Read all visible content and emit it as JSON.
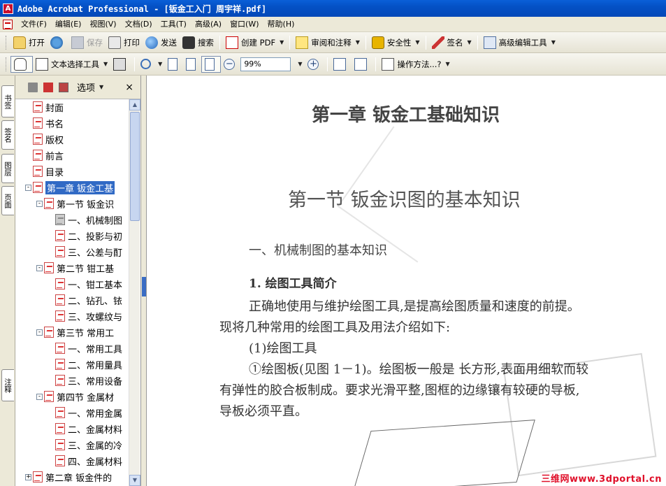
{
  "window": {
    "title": "Adobe Acrobat Professional - [钣金工入门 周宇祥.pdf]"
  },
  "menubar": {
    "items": [
      "文件(F)",
      "编辑(E)",
      "视图(V)",
      "文档(D)",
      "工具(T)",
      "高级(A)",
      "窗口(W)",
      "帮助(H)"
    ]
  },
  "toolbar1": {
    "open": "打开",
    "save": "保存",
    "print": "打印",
    "send": "发送",
    "search": "搜索",
    "create_pdf": "创建 PDF",
    "review": "审阅和注释",
    "security": "安全性",
    "sign": "签名",
    "advanced_edit": "高级编辑工具"
  },
  "toolbar2": {
    "text_select": "文本选择工具",
    "zoom_value": "99%",
    "how_to": "操作方法...?"
  },
  "lefttabs": [
    "书签",
    "签名",
    "图层",
    "页面",
    "注释"
  ],
  "nav": {
    "options": "选项",
    "close": "×"
  },
  "bookmarks": [
    {
      "label": "封面",
      "level": 0,
      "toggle": ""
    },
    {
      "label": "书名",
      "level": 0,
      "toggle": ""
    },
    {
      "label": "版权",
      "level": 0,
      "toggle": ""
    },
    {
      "label": "前言",
      "level": 0,
      "toggle": ""
    },
    {
      "label": "目录",
      "level": 0,
      "toggle": ""
    },
    {
      "label": "第一章  钣金工基",
      "level": 0,
      "toggle": "−",
      "selected": true
    },
    {
      "label": "第一节  钣金识",
      "level": 1,
      "toggle": "−"
    },
    {
      "label": "一、机械制图",
      "level": 2,
      "toggle": "",
      "gray": true
    },
    {
      "label": "二、投影与初",
      "level": 2,
      "toggle": ""
    },
    {
      "label": "三、公差与酊",
      "level": 2,
      "toggle": ""
    },
    {
      "label": "第二节  钳工基",
      "level": 1,
      "toggle": "−"
    },
    {
      "label": "一、钳工基本",
      "level": 2,
      "toggle": ""
    },
    {
      "label": "二、钻孔、铱",
      "level": 2,
      "toggle": ""
    },
    {
      "label": "三、攻螺纹与",
      "level": 2,
      "toggle": ""
    },
    {
      "label": "第三节  常用工",
      "level": 1,
      "toggle": "−"
    },
    {
      "label": "一、常用工具",
      "level": 2,
      "toggle": ""
    },
    {
      "label": "二、常用量具",
      "level": 2,
      "toggle": ""
    },
    {
      "label": "三、常用设备",
      "level": 2,
      "toggle": ""
    },
    {
      "label": "第四节  金属材",
      "level": 1,
      "toggle": "−"
    },
    {
      "label": "一、常用金属",
      "level": 2,
      "toggle": ""
    },
    {
      "label": "二、金属材料",
      "level": 2,
      "toggle": ""
    },
    {
      "label": "三、金属的冷",
      "level": 2,
      "toggle": ""
    },
    {
      "label": "四、金属材料",
      "level": 2,
      "toggle": ""
    },
    {
      "label": "第二章  钣金件的",
      "level": 0,
      "toggle": "+"
    }
  ],
  "document": {
    "chapter": "第一章    钣金工基础知识",
    "section": "第一节    钣金识图的基本知识",
    "subsection": "一、机械制图的基本知识",
    "heading1": "1. 绘图工具简介",
    "para1_line1": "正确地使用与维护绘图工具,是提高绘图质量和速度的前提。",
    "para1_line2": "现将几种常用的绘图工具及用法介绍如下:",
    "item1": "(1)绘图工具",
    "para2_line1": "①绘图板(见图 1－1)。绘图板一般是 长方形,表面用细软而较",
    "para2_line2": "有弹性的胶合板制成。要求光滑平整,图框的边缘镶有较硬的导板,",
    "para2_line3": "导板必须平直。"
  },
  "watermark": "三维网www.3dportal.cn"
}
